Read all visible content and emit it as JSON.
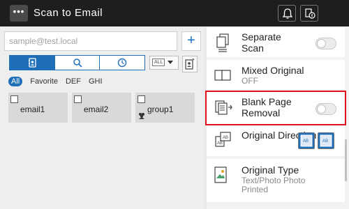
{
  "header": {
    "title": "Scan to Email",
    "menu_label": "•••",
    "icons": [
      "bell-icon",
      "job-history-icon"
    ]
  },
  "address": {
    "placeholder": "sample@test.local",
    "add_label": "+"
  },
  "view_tabs": [
    "address-book-icon",
    "search-icon",
    "history-icon"
  ],
  "dropdown": {
    "selected": "ALL"
  },
  "filters": [
    "All",
    "Favorite",
    "DEF",
    "GHI"
  ],
  "destinations": [
    {
      "name": "email1",
      "type": "email"
    },
    {
      "name": "email2",
      "type": "email"
    },
    {
      "name": "group1",
      "type": "group"
    }
  ],
  "settings": [
    {
      "label": "Separate Scan",
      "icon": "separate-scan-icon",
      "toggle": false
    },
    {
      "label": "Mixed Original",
      "sub": "OFF",
      "icon": "mixed-original-icon"
    },
    {
      "label": "Blank Page Removal",
      "icon": "blank-page-removal-icon",
      "toggle": false,
      "highlighted": true
    },
    {
      "label": "Original Direction",
      "icon": "original-direction-icon"
    },
    {
      "label": "Original Type",
      "sub": "Text/Photo Photo Printed",
      "icon": "original-type-icon"
    }
  ],
  "colors": {
    "accent": "#1f6fb8",
    "highlight": "#e01020",
    "header": "#1e1e1e"
  }
}
